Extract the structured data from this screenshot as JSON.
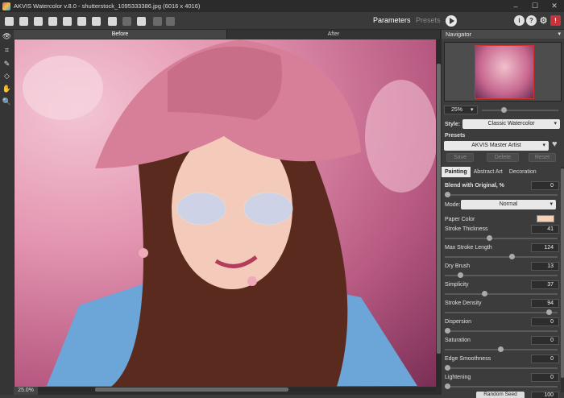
{
  "window": {
    "title": "AKVIS Watercolor v.8.0 - shutterstock_1095333386.jpg (6016 x 4016)"
  },
  "toolbar": {
    "buttons": [
      "home-icon",
      "open-icon",
      "save-icon",
      "print-icon",
      "batch-icon",
      "share-icon",
      "presets-icon",
      "flip-icon",
      "undo-layer-icon",
      "undo-icon",
      "redo-icon"
    ],
    "parameters_label": "Parameters",
    "presets_label": "Presets"
  },
  "view_tabs": {
    "before": "Before",
    "after": "After"
  },
  "canvas": {
    "zoom": "25.0%"
  },
  "navigator": {
    "title": "Navigator",
    "zoom": "25%"
  },
  "style": {
    "label": "Style:",
    "value": "Classic Watercolor"
  },
  "presets": {
    "label": "Presets",
    "value": "AKVIS Master Artist",
    "save": "Save",
    "delete": "Delete",
    "reset": "Reset"
  },
  "param_tabs": {
    "painting": "Painting",
    "abstract": "Abstract Art",
    "decoration": "Decoration"
  },
  "params": {
    "blend_label": "Blend with Original, %",
    "blend_value": "0",
    "mode_label": "Mode:",
    "mode_value": "Normal",
    "paper_color_label": "Paper Color",
    "paper_color": "#f6d2b8",
    "stroke_thickness_label": "Stroke Thickness",
    "stroke_thickness": "41",
    "max_stroke_length_label": "Max Stroke Length",
    "max_stroke_length": "124",
    "dry_brush_label": "Dry Brush",
    "dry_brush": "13",
    "simplicity_label": "Simplicity",
    "simplicity": "37",
    "stroke_density_label": "Stroke Density",
    "stroke_density": "94",
    "dispersion_label": "Dispersion",
    "dispersion": "0",
    "saturation_label": "Saturation",
    "saturation": "0",
    "edge_smoothness_label": "Edge Smoothness",
    "edge_smoothness": "0",
    "lightening_label": "Lightening",
    "lightening": "0",
    "random_seed_label": "Random Seed",
    "random_seed": "100"
  }
}
